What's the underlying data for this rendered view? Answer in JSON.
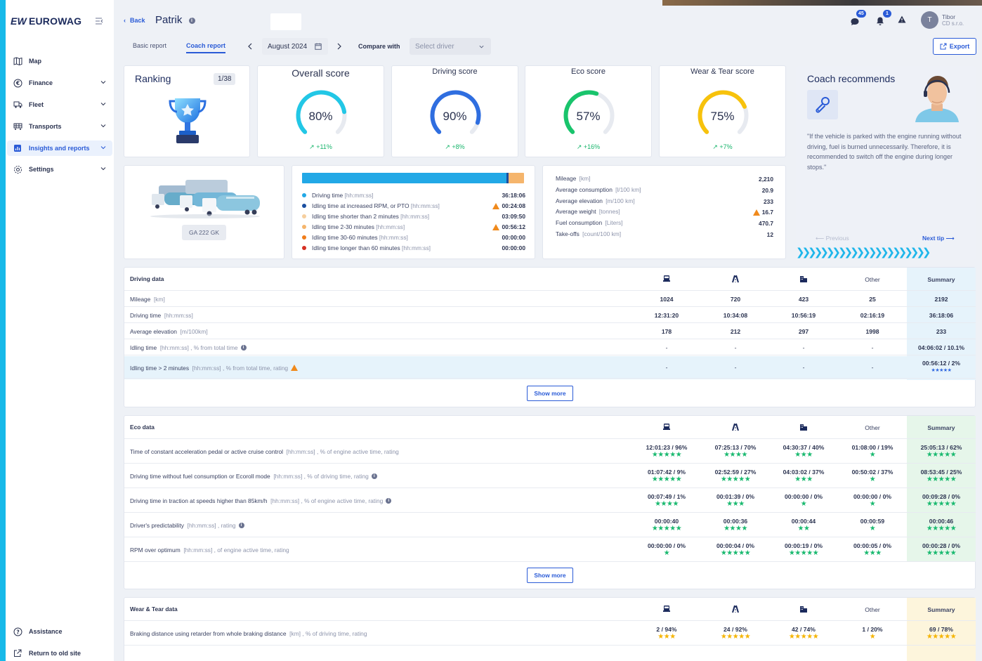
{
  "sidebar": {
    "logo_mark": "EW",
    "logo_text": "EUROWAG",
    "items": [
      {
        "label": "Map"
      },
      {
        "label": "Finance"
      },
      {
        "label": "Fleet"
      },
      {
        "label": "Transports"
      },
      {
        "label": "Insights and reports"
      },
      {
        "label": "Settings"
      }
    ],
    "assistance": "Assistance",
    "return_old": "Return to old site"
  },
  "header": {
    "back": "Back",
    "driver": "Patrik",
    "notifications": {
      "messages": "45",
      "bell": "1"
    },
    "user": {
      "initial": "T",
      "name": "Tibor",
      "company": "CD s.r.o."
    }
  },
  "toolbar": {
    "tabs": [
      "Basic report",
      "Coach report"
    ],
    "month": "August 2024",
    "compare_label": "Compare with",
    "select_placeholder": "Select driver",
    "export": "Export"
  },
  "ranking": {
    "title": "Ranking",
    "value": "1/38"
  },
  "scores": [
    {
      "title": "Overall score",
      "value": "80%",
      "delta": "+11%",
      "pct": 0.8,
      "color": "#22c7e6"
    },
    {
      "title": "Driving score",
      "value": "90%",
      "delta": "+8%",
      "pct": 0.9,
      "color": "#2f6ee0"
    },
    {
      "title": "Eco score",
      "value": "57%",
      "delta": "+16%",
      "pct": 0.57,
      "color": "#19c46c"
    },
    {
      "title": "Wear & Tear score",
      "value": "75%",
      "delta": "+7%",
      "pct": 0.75,
      "color": "#f7c20c"
    }
  ],
  "vehicle": {
    "plate": "GA 222 GK"
  },
  "time_breakdown": {
    "bar": [
      {
        "fraction": 0.92,
        "color": "#22a8e6"
      },
      {
        "fraction": 0.01,
        "color": "#1a4fa0"
      },
      {
        "fraction": 0.0,
        "color": "#f6cf9e"
      },
      {
        "fraction": 0.07,
        "color": "#f5b56c"
      }
    ],
    "rows": [
      {
        "label": "Driving time",
        "unit": "[hh:mm:ss]",
        "value": "36:18:06",
        "color": "#22a8e6",
        "warn": false
      },
      {
        "label": "Idling time at increased RPM, or PTO",
        "unit": "[hh:mm:ss]",
        "value": "00:24:08",
        "color": "#1a4fa0",
        "warn": true
      },
      {
        "label": "Idling time shorter than 2 minutes",
        "unit": "[hh:mm:ss]",
        "value": "03:09:50",
        "color": "#f6cf9e",
        "warn": false
      },
      {
        "label": "Idling time 2-30 minutes",
        "unit": "[hh:mm:ss]",
        "value": "00:56:12",
        "color": "#f5b56c",
        "warn": true
      },
      {
        "label": "Idling time 30-60 minutes",
        "unit": "[hh:mm:ss]",
        "value": "00:00:00",
        "color": "#f07d1a",
        "warn": false
      },
      {
        "label": "Idling time longer than 60 minutes",
        "unit": "[hh:mm:ss]",
        "value": "00:00:00",
        "color": "#d63023",
        "warn": false
      }
    ]
  },
  "stats": [
    {
      "label": "Mileage",
      "unit": "[km]",
      "value": "2,210",
      "warn": false
    },
    {
      "label": "Average consumption",
      "unit": "[l/100 km]",
      "value": "20.9",
      "warn": false
    },
    {
      "label": "Average elevation",
      "unit": "[m/100 km]",
      "value": "233",
      "warn": false
    },
    {
      "label": "Average weight",
      "unit": "[tonnes]",
      "value": "16.7",
      "warn": true
    },
    {
      "label": "Fuel consumption",
      "unit": "[Liters]",
      "value": "470.7",
      "warn": false
    },
    {
      "label": "Take-offs",
      "unit": "[count/100 km]",
      "value": "12",
      "warn": false
    }
  ],
  "coach": {
    "title": "Coach recommends",
    "quote": "\"If the vehicle is parked with the engine running without driving, fuel is burned unnecessarily. Therefore, it is recommended to switch off the engine during longer stops.\"",
    "previous": "Previous",
    "next": "Next tip",
    "chevrons": "❯❯❯❯❯❯❯❯❯❯❯❯❯❯❯❯❯❯❯❯❯❯"
  },
  "columns": {
    "other": "Other",
    "summary": "Summary"
  },
  "driving_data": {
    "title": "Driving data",
    "rows": [
      {
        "label": "Mileage",
        "unit": "[km]",
        "cells": [
          "1024",
          "720",
          "423",
          "25",
          "2192"
        ]
      },
      {
        "label": "Driving time",
        "unit": "[hh:mm:ss]",
        "cells": [
          "12:31:20",
          "10:34:08",
          "10:56:19",
          "02:16:19",
          "36:18:06"
        ]
      },
      {
        "label": "Average elevation",
        "unit": "[m/100km]",
        "cells": [
          "178",
          "212",
          "297",
          "1998",
          "233"
        ]
      },
      {
        "label": "Idling time",
        "unit": "[hh:mm:ss] , % from total time",
        "cells": [
          "-",
          "-",
          "-",
          "-",
          "04:06:02 / 10.1%"
        ]
      },
      {
        "label": "Idling time > 2 minutes",
        "unit": "[hh:mm:ss] , % from total time, rating",
        "cells": [
          "-",
          "-",
          "-",
          "-",
          "00:56:12 / 2%"
        ]
      }
    ],
    "summary_stars_last": "★★★★★",
    "show_more": "Show more"
  },
  "eco_data": {
    "title": "Eco data",
    "rows": [
      {
        "label": "Time of constant acceleration pedal or active cruise control",
        "unit": "[hh:mm:ss] , % of engine active time, rating",
        "cells": [
          "12:01:23 / 96%",
          "07:25:13 / 70%",
          "04:30:37 / 40%",
          "01:08:00 / 19%",
          "25:05:13 / 62%"
        ],
        "stars": [
          "★★★★★",
          "★★★★",
          "★★★",
          "★",
          "★★★★★"
        ]
      },
      {
        "label": "Driving time without fuel consumption or Ecoroll mode",
        "unit": "[hh:mm:ss] , % of driving time, rating",
        "cells": [
          "01:07:42 / 9%",
          "02:52:59 / 27%",
          "04:03:02 / 37%",
          "00:50:02 / 37%",
          "08:53:45 / 25%"
        ],
        "stars": [
          "★★★★★",
          "★★★★★",
          "★★★",
          "★",
          "★★★★★"
        ]
      },
      {
        "label": "Driving time in traction at speeds higher than 85km/h",
        "unit": "[hh:mm:ss] , % of engine active time, rating",
        "cells": [
          "00:07:49 / 1%",
          "00:01:39 / 0%",
          "00:00:00 / 0%",
          "00:00:00 / 0%",
          "00:09:28 / 0%"
        ],
        "stars": [
          "★★★★",
          "★★★",
          "★",
          "★",
          "★★★★★"
        ]
      },
      {
        "label": "Driver's predictability",
        "unit": "[hh:mm:ss] , rating",
        "cells": [
          "00:00:40",
          "00:00:36",
          "00:00:44",
          "00:00:59",
          "00:00:46"
        ],
        "stars": [
          "★★★★★",
          "★★★★",
          "★★",
          "★",
          "★★★★★"
        ]
      },
      {
        "label": "RPM over optimum",
        "unit": "[hh:mm:ss] , of engine active time, rating",
        "cells": [
          "00:00:00 / 0%",
          "00:00:04 / 0%",
          "00:00:19 / 0%",
          "00:00:05 / 0%",
          "00:00:28 / 0%"
        ],
        "stars": [
          "★",
          "★★★★★",
          "★★★★★",
          "★★★",
          "★★★★★"
        ]
      }
    ],
    "show_more": "Show more"
  },
  "wear_data": {
    "title": "Wear & Tear data",
    "rows": [
      {
        "label": "Braking distance using retarder from whole braking distance",
        "unit": "[km] , % of driving time, rating",
        "cells": [
          "2 / 94%",
          "24 / 92%",
          "42 / 74%",
          "1 / 20%",
          "69 / 78%"
        ],
        "stars": [
          "★★★",
          "★★★★★",
          "★★★★★",
          "★",
          "★★★★★"
        ]
      }
    ]
  }
}
